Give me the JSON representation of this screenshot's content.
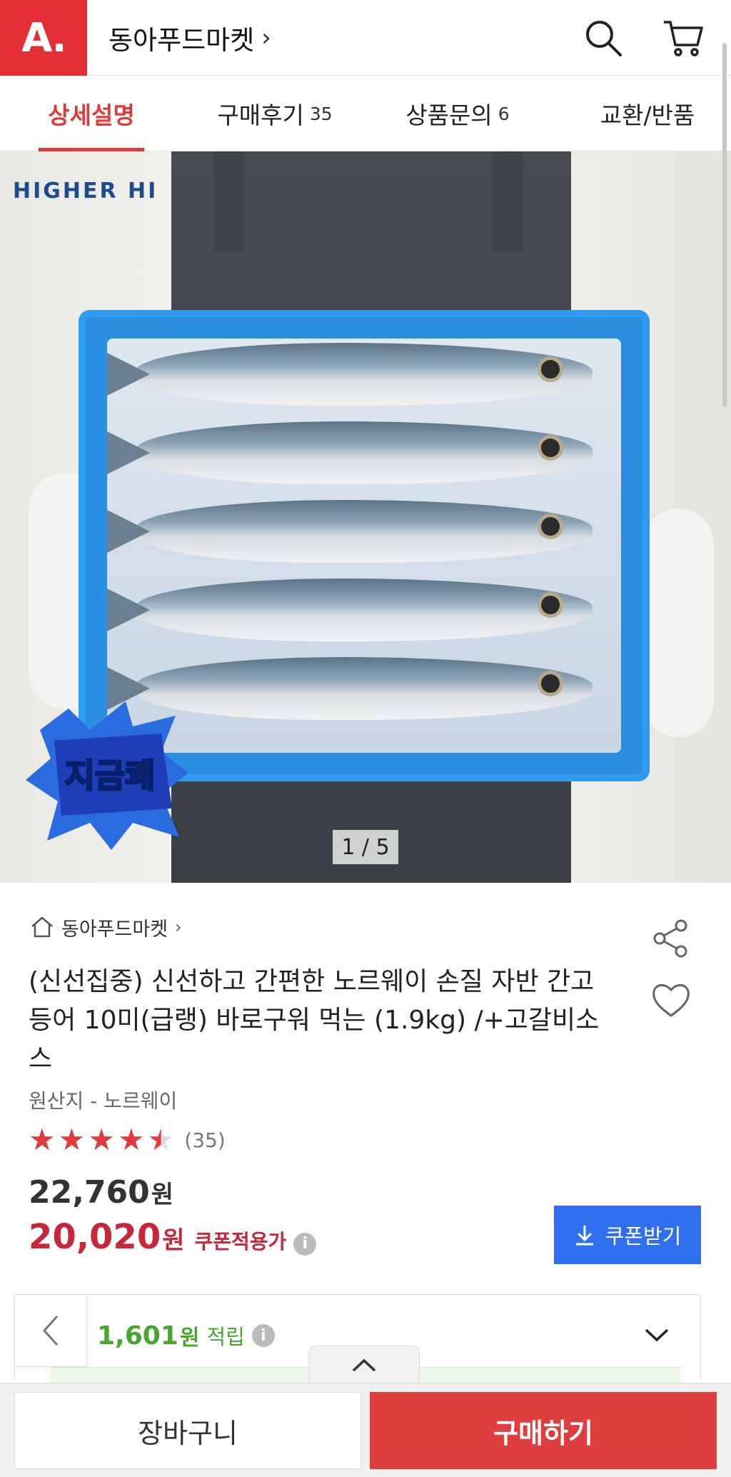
{
  "header": {
    "logo_text": "A.",
    "store_name": "동아푸드마켓",
    "store_chevron": "›",
    "icons": [
      "search-icon",
      "cart-icon"
    ]
  },
  "tabs": [
    {
      "label": "상세설명",
      "count": ""
    },
    {
      "label": "구매후기",
      "count": "35"
    },
    {
      "label": "상품문의",
      "count": "6"
    },
    {
      "label": "교환/반품",
      "count": ""
    }
  ],
  "hero": {
    "brand_mark": "HIGHER HI",
    "badge_text": "지금쾌",
    "pager": "1 / 5"
  },
  "product": {
    "shop_name": "동아푸드마켓",
    "shop_chevron": "›",
    "title": "(신선집중) 신선하고 간편한 노르웨이 손질 자반 간고등어 10미(급랭) 바로구워 먹는 (1.9kg) /+고갈비소스",
    "origin": "원산지 - 노르웨이",
    "rating": 4.5,
    "review_count": "(35)",
    "price_original": "22,760",
    "price_sale": "20,020",
    "price_unit": "원",
    "coupon_price_label": "쿠폰적용가",
    "coupon_button": "쿠폰받기"
  },
  "points": {
    "amount": "1,601",
    "unit": "원",
    "label": "적립"
  },
  "bottom_bar": {
    "cart_label": "장바구니",
    "buy_label": "구매하기"
  },
  "colors": {
    "brand_red": "#e52f37",
    "sale_red": "#c7273a",
    "coupon_blue": "#2f6ff0",
    "points_green": "#4aa62e"
  }
}
